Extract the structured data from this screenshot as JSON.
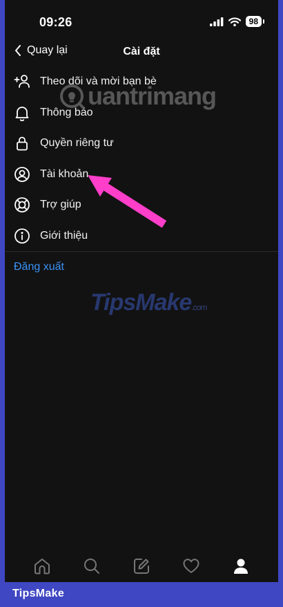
{
  "status": {
    "time": "09:26",
    "battery": "98"
  },
  "header": {
    "back_label": "Quay lại",
    "title": "Cài đặt"
  },
  "menu": [
    {
      "label": "Theo dõi và mời bạn bè",
      "icon": "add-person-icon"
    },
    {
      "label": "Thông báo",
      "icon": "bell-icon"
    },
    {
      "label": "Quyền riêng tư",
      "icon": "lock-icon"
    },
    {
      "label": "Tài khoản",
      "icon": "account-circle-icon"
    },
    {
      "label": "Trợ giúp",
      "icon": "lifebuoy-icon"
    },
    {
      "label": "Giới thiệu",
      "icon": "info-icon"
    }
  ],
  "logout_label": "Đăng xuất",
  "watermarks": {
    "top": "uantrimang",
    "middle": "TipsMake",
    "middle_suffix": ".com"
  },
  "tabs": [
    "home-icon",
    "search-icon",
    "compose-icon",
    "heart-icon",
    "profile-icon"
  ],
  "footer_brand": "TipsMake",
  "colors": {
    "background": "#121212",
    "link": "#3b93f7",
    "annotation_arrow": "#ff3ec9",
    "frame": "#3f47c2"
  }
}
